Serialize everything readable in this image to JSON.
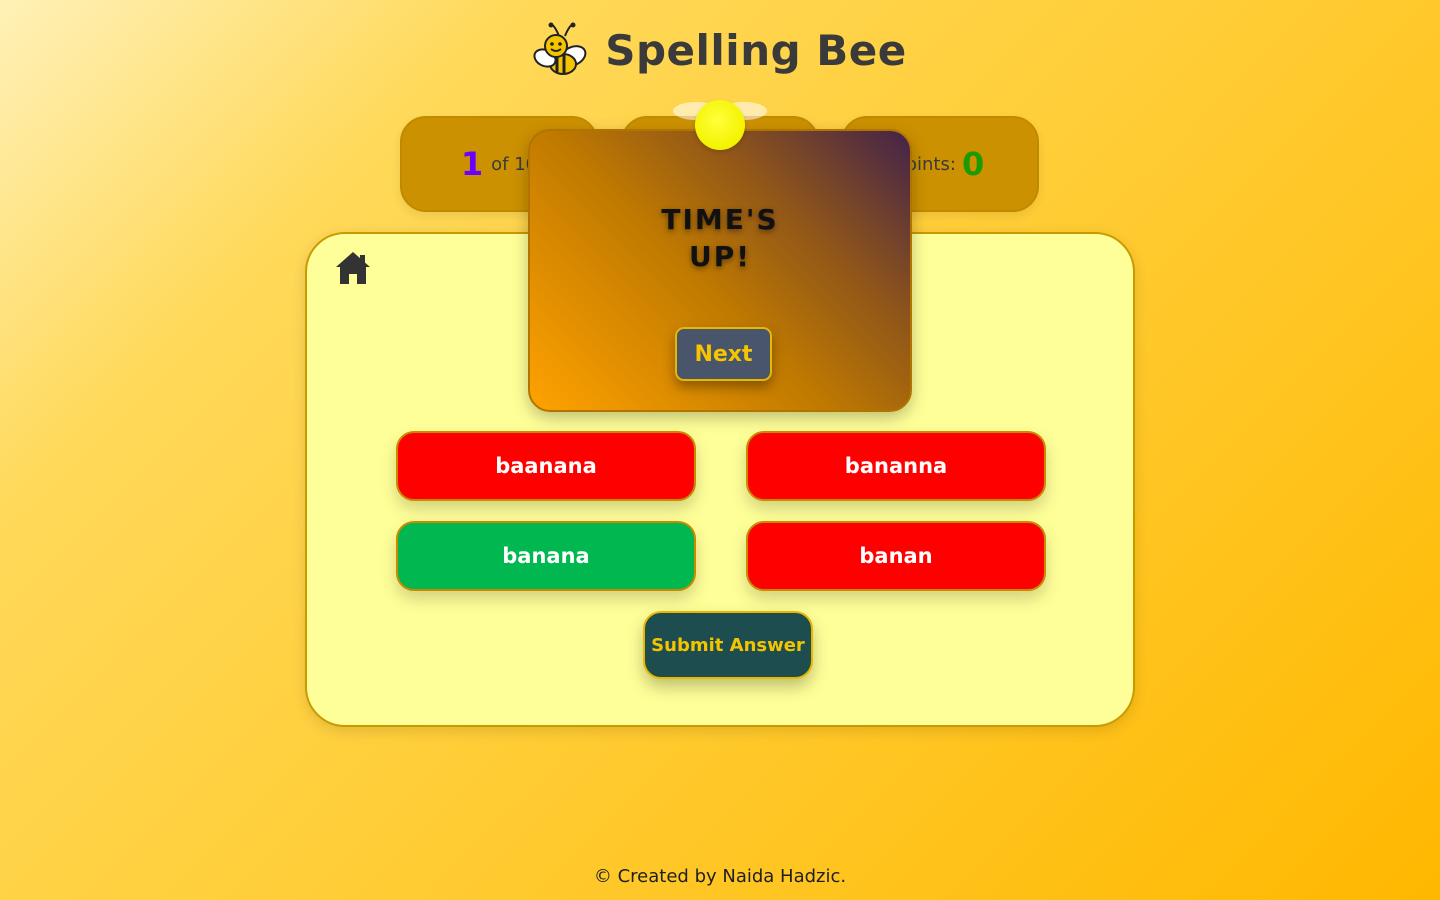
{
  "header": {
    "title": "Spelling Bee",
    "logo_icon": "bee-icon"
  },
  "stats": {
    "question_current": "1",
    "question_total_text": "of 10",
    "points_label": "Points:",
    "points_value": "0"
  },
  "card": {
    "home_icon": "home-icon",
    "options": [
      {
        "label": "baanana",
        "state": "incorrect"
      },
      {
        "label": "bananna",
        "state": "incorrect"
      },
      {
        "label": "banana",
        "state": "correct"
      },
      {
        "label": "banan",
        "state": "incorrect"
      }
    ],
    "submit_label": "Submit Answer"
  },
  "modal": {
    "title_line1": "TIME'S",
    "title_line2": "UP!",
    "next_label": "Next"
  },
  "footer": {
    "text": "© Created by Naida Hadzic."
  },
  "colors": {
    "background": "#ffcc33",
    "card": "#ffff99",
    "incorrect": "#ff0000",
    "correct": "#00b84f",
    "submit_bg": "#1e4d4f",
    "accent_text": "#f5c400",
    "question_number": "#6a00ff",
    "points_number": "#1a9c00"
  }
}
